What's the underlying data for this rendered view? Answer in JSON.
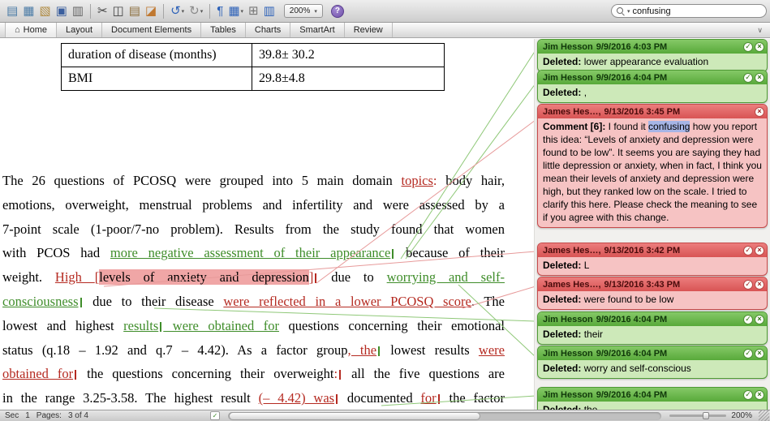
{
  "toolbar": {
    "buttons": [
      {
        "name": "new-document",
        "glyph": "▤",
        "color": "#4a7ba6"
      },
      {
        "name": "gallery",
        "glyph": "▦",
        "color": "#4a7ba6"
      },
      {
        "name": "open",
        "glyph": "▧",
        "color": "#b08a3e"
      },
      {
        "name": "save",
        "glyph": "▣",
        "color": "#3b5f9e"
      },
      {
        "name": "print",
        "glyph": "▥",
        "color": "#666666",
        "sep_after": true
      },
      {
        "name": "cut",
        "glyph": "✂",
        "color": "#444444"
      },
      {
        "name": "copy",
        "glyph": "◫",
        "color": "#444444"
      },
      {
        "name": "paste",
        "glyph": "▤",
        "color": "#8a6d3b"
      },
      {
        "name": "format-painter",
        "glyph": "◪",
        "color": "#c07830",
        "sep_after": true
      },
      {
        "name": "undo",
        "glyph": "↺",
        "color": "#2e62b8",
        "dropdown": true
      },
      {
        "name": "redo",
        "glyph": "↻",
        "color": "#8a8a8a",
        "dropdown": true,
        "sep_after": true
      },
      {
        "name": "show-paragraph-marks",
        "glyph": "¶",
        "color": "#2e62b8"
      },
      {
        "name": "view-options",
        "glyph": "▦",
        "color": "#2e62b8",
        "dropdown": true
      },
      {
        "name": "show-ruler",
        "glyph": "⊞",
        "color": "#777777"
      },
      {
        "name": "columns",
        "glyph": "▥",
        "color": "#2e62b8"
      }
    ],
    "zoom_value": "200%",
    "help_glyph": "?",
    "search_value": "confusing"
  },
  "ribbon": {
    "tabs": [
      {
        "label": "Home",
        "icon": "⌂"
      },
      {
        "label": "Layout"
      },
      {
        "label": "Document Elements"
      },
      {
        "label": "Tables"
      },
      {
        "label": "Charts"
      },
      {
        "label": "SmartArt"
      },
      {
        "label": "Review"
      }
    ],
    "collapse_glyph": "∨"
  },
  "document": {
    "table": {
      "rows": [
        [
          "duration of disease (months)",
          "39.8± 30.2"
        ],
        [
          "BMI",
          "29.8±4.8"
        ]
      ]
    },
    "paragraph": {
      "lines": [
        [
          {
            "t": "The 26 questions of PCOSQ were grouped into 5 main domain ",
            "c": "n"
          },
          {
            "t": "topics",
            "c": "ru"
          },
          {
            "t": ":",
            "c": "r"
          },
          {
            "t": " body hair,",
            "c": "n"
          }
        ],
        [
          {
            "t": "emotions, overweight, menstrual problems and infertility and were assessed by a",
            "c": "n"
          }
        ],
        [
          {
            "t": "7-point scale (1-poor/7-no problem). Results from the study found that women",
            "c": "n"
          }
        ],
        [
          {
            "t": "with PCOS had ",
            "c": "n"
          },
          {
            "t": "more negative assessment of their appearance",
            "c": "gu"
          },
          {
            "m": "g"
          },
          {
            "t": " because of their",
            "c": "n"
          }
        ],
        [
          {
            "t": "weight. ",
            "c": "n"
          },
          {
            "t": "High ",
            "c": "ru"
          },
          {
            "t": "[",
            "c": "r"
          },
          {
            "t": "levels of anxiety and depression",
            "c": "cm"
          },
          {
            "t": "]",
            "c": "r"
          },
          {
            "m": "r"
          },
          {
            "t": " due to ",
            "c": "n"
          },
          {
            "t": "worrying and self-",
            "c": "gu"
          }
        ],
        [
          {
            "t": "consciousness",
            "c": "gu"
          },
          {
            "m": "g"
          },
          {
            "t": " due to their disease ",
            "c": "n"
          },
          {
            "t": "were reflected in a lower PCOSQ score",
            "c": "ru"
          },
          {
            "t": ". The",
            "c": "n"
          }
        ],
        [
          {
            "t": "lowest and highest ",
            "c": "n"
          },
          {
            "t": "results",
            "c": "gu"
          },
          {
            "m": "g"
          },
          {
            "t": " were obtained for",
            "c": "gu"
          },
          {
            "t": " questions concerning their emotional",
            "c": "n"
          }
        ],
        [
          {
            "t": "status (q.18 – 1.92 and q.7 – 4.42). As a factor group",
            "c": "n"
          },
          {
            "t": ", the",
            "c": "ru"
          },
          {
            "m": "g"
          },
          {
            "t": " lowest results ",
            "c": "n"
          },
          {
            "t": "were",
            "c": "ru"
          }
        ],
        [
          {
            "t": "obtained for",
            "c": "ru"
          },
          {
            "m": "r"
          },
          {
            "t": " the questions concerning their overweight",
            "c": "n"
          },
          {
            "t": ":",
            "c": "r"
          },
          {
            "m": "r"
          },
          {
            "t": " all the five questions are",
            "c": "n"
          }
        ],
        [
          {
            "t": "in the range 3.25-3.58. The highest result ",
            "c": "n"
          },
          {
            "t": "(– 4.42) was",
            "c": "ru"
          },
          {
            "m": "r"
          },
          {
            "t": " documented ",
            "c": "n"
          },
          {
            "t": "for",
            "c": "ru"
          },
          {
            "m": "r"
          },
          {
            "t": " the factor",
            "c": "n"
          }
        ]
      ]
    }
  },
  "review_pane": {
    "balloons": [
      {
        "style": "green",
        "kind": "deletion",
        "author": "Jim Hesson",
        "time": "9/9/2016 4:03 PM",
        "buttons": [
          "accept",
          "close"
        ],
        "body": [
          {
            "t": "Deleted: ",
            "c": "lbl"
          },
          {
            "t": "lower appearance evaluation"
          }
        ]
      },
      {
        "style": "green",
        "kind": "deletion",
        "author": "Jim Hesson",
        "time": "9/9/2016 4:04 PM",
        "buttons": [
          "accept",
          "close"
        ],
        "body": [
          {
            "t": "Deleted: ",
            "c": "lbl"
          },
          {
            "t": ","
          }
        ]
      },
      {
        "style": "red",
        "kind": "comment",
        "author": "James Hes…,",
        "time": "9/13/2016 3:45 PM",
        "buttons": [
          "close"
        ],
        "body": [
          {
            "t": "Comment [6]: ",
            "c": "lbl"
          },
          {
            "t": "I found it "
          },
          {
            "t": "confusing",
            "c": "find"
          },
          {
            "t": " how you report this idea: “Levels of anxiety and depression were found to be low”. It seems you are saying they had little depression or anxiety, when in fact, I think you mean their levels of anxiety and depression were high, but they ranked low on the scale. I tried to clarify this here. Please check the meaning to see if you agree with this change."
          }
        ]
      },
      {
        "style": "red",
        "kind": "deletion",
        "author": "James Hes…,",
        "time": "9/13/2016 3:42 PM",
        "buttons": [
          "accept",
          "close"
        ],
        "body": [
          {
            "t": "Deleted: ",
            "c": "lbl"
          },
          {
            "t": "L"
          }
        ]
      },
      {
        "style": "red",
        "kind": "deletion",
        "author": "James Hes…,",
        "time": "9/13/2016 3:43 PM",
        "buttons": [
          "accept",
          "close"
        ],
        "body": [
          {
            "t": "Deleted: ",
            "c": "lbl"
          },
          {
            "t": "were found to be low"
          }
        ]
      },
      {
        "style": "green",
        "kind": "deletion",
        "author": "Jim Hesson",
        "time": "9/9/2016 4:04 PM",
        "buttons": [
          "accept",
          "close"
        ],
        "body": [
          {
            "t": "Deleted: ",
            "c": "lbl"
          },
          {
            "t": "their"
          }
        ]
      },
      {
        "style": "green",
        "kind": "deletion",
        "author": "Jim Hesson",
        "time": "9/9/2016 4:04 PM",
        "buttons": [
          "accept",
          "close"
        ],
        "body": [
          {
            "t": "Deleted: ",
            "c": "lbl"
          },
          {
            "t": "worry and self-conscious"
          }
        ]
      },
      {
        "style": "green",
        "kind": "deletion",
        "author": "Jim Hesson",
        "time": "9/9/2016 4:04 PM",
        "buttons": [
          "accept",
          "close"
        ],
        "body": [
          {
            "t": "Deleted: ",
            "c": "lbl"
          },
          {
            "t": "the"
          }
        ]
      }
    ]
  },
  "status_bar": {
    "sec_label": "Sec",
    "sec_value": "1",
    "pages_label": "Pages:",
    "pages_value": "3 of 4",
    "zoom": "200%"
  }
}
